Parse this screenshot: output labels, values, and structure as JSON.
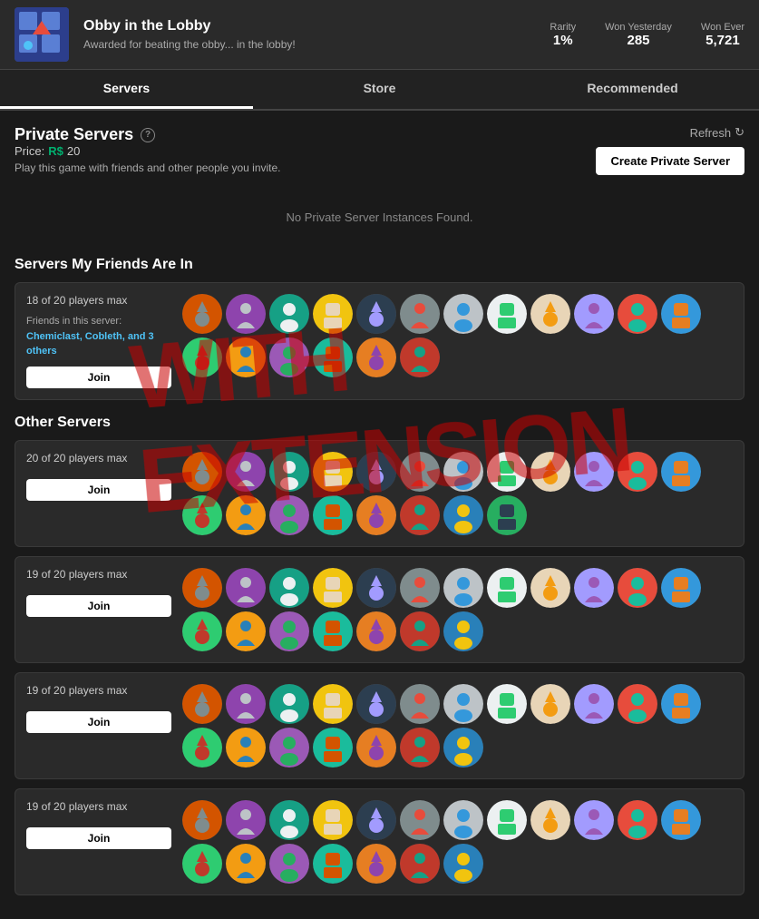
{
  "header": {
    "game_title": "Obby in the Lobby",
    "game_desc": "Awarded for beating the obby... in the lobby!",
    "stats": {
      "rarity_label": "Rarity",
      "rarity_value": "1%",
      "won_yesterday_label": "Won Yesterday",
      "won_yesterday_value": "285",
      "won_ever_label": "Won Ever",
      "won_ever_value": "5,721"
    }
  },
  "tabs": [
    {
      "label": "Servers",
      "active": true
    },
    {
      "label": "Store",
      "active": false
    },
    {
      "label": "Recommended",
      "active": false
    }
  ],
  "private_servers": {
    "title": "Private Servers",
    "help_char": "?",
    "refresh_label": "Refresh",
    "create_label": "Create Private Server",
    "price_label": "Price:",
    "price_value": "20",
    "description": "Play this game with friends and other people you invite.",
    "no_instances": "No Private Server Instances Found."
  },
  "friends_section": {
    "title": "Servers My Friends Are In",
    "card": {
      "player_count": "18 of 20 players max",
      "friends_label": "Friends in this server:",
      "friends": "Chemiclast, Cobleth, and 3 others",
      "join_label": "Join",
      "avatar_count": 18
    }
  },
  "other_servers": {
    "title": "Other Servers",
    "cards": [
      {
        "player_count": "20 of 20 players max",
        "join_label": "Join",
        "avatar_count": 20
      },
      {
        "player_count": "19 of 20 players max",
        "join_label": "Join",
        "avatar_count": 19
      },
      {
        "player_count": "19 of 20 players max",
        "join_label": "Join",
        "avatar_count": 19
      },
      {
        "player_count": "19 of 20 players max",
        "join_label": "Join",
        "avatar_count": 19
      }
    ]
  },
  "avatar_colors": [
    "#e74c3c",
    "#3498db",
    "#2ecc71",
    "#f39c12",
    "#9b59b6",
    "#1abc9c",
    "#e67e22",
    "#c0392b",
    "#2980b9",
    "#27ae60",
    "#d35400",
    "#8e44ad",
    "#16a085",
    "#f1c40f",
    "#2c3e50",
    "#7f8c8d",
    "#bdc3c7",
    "#ecf0f1",
    "#e8d5b7",
    "#a29bfe"
  ]
}
